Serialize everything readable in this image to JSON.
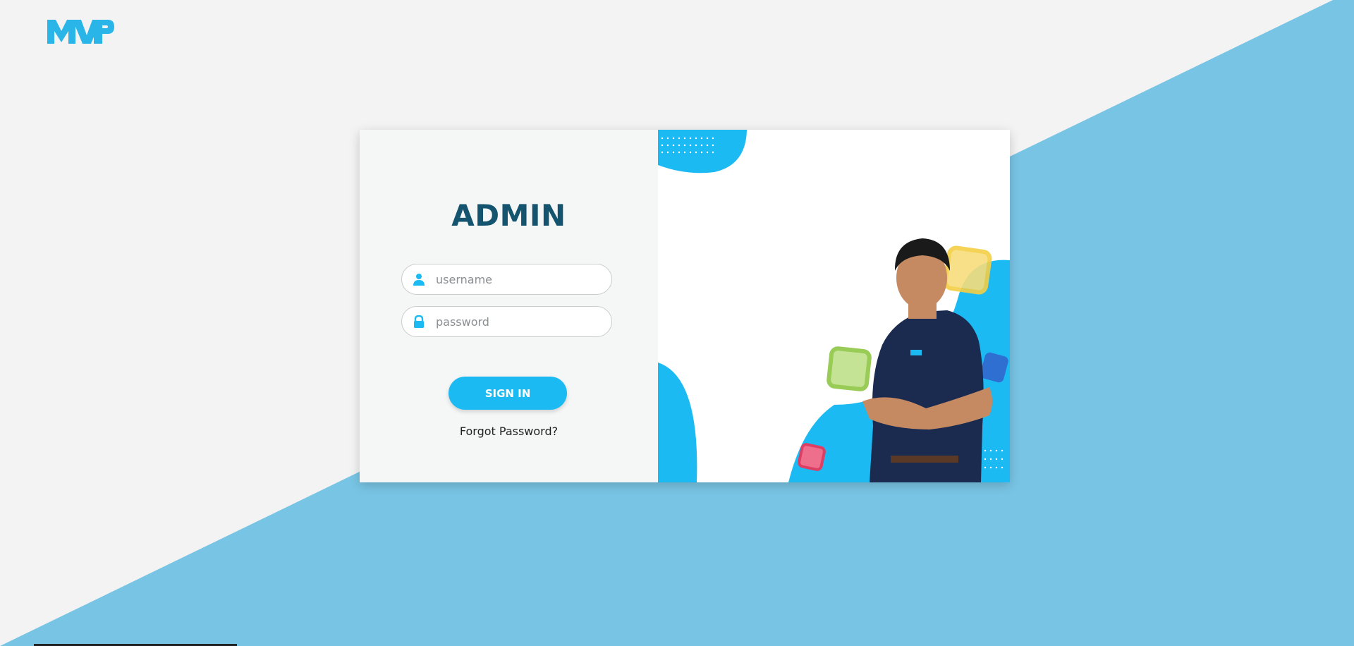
{
  "brand": {
    "logo_text": "MVP",
    "accent": "#1cbaf2",
    "bg_blue": "#78c4e4"
  },
  "login": {
    "title": "ADMIN",
    "username_placeholder": "username",
    "password_placeholder": "password",
    "signin_label": "SIGN IN",
    "forgot_label": "Forgot Password?"
  },
  "icons": {
    "user": "user-icon",
    "lock": "lock-icon"
  }
}
